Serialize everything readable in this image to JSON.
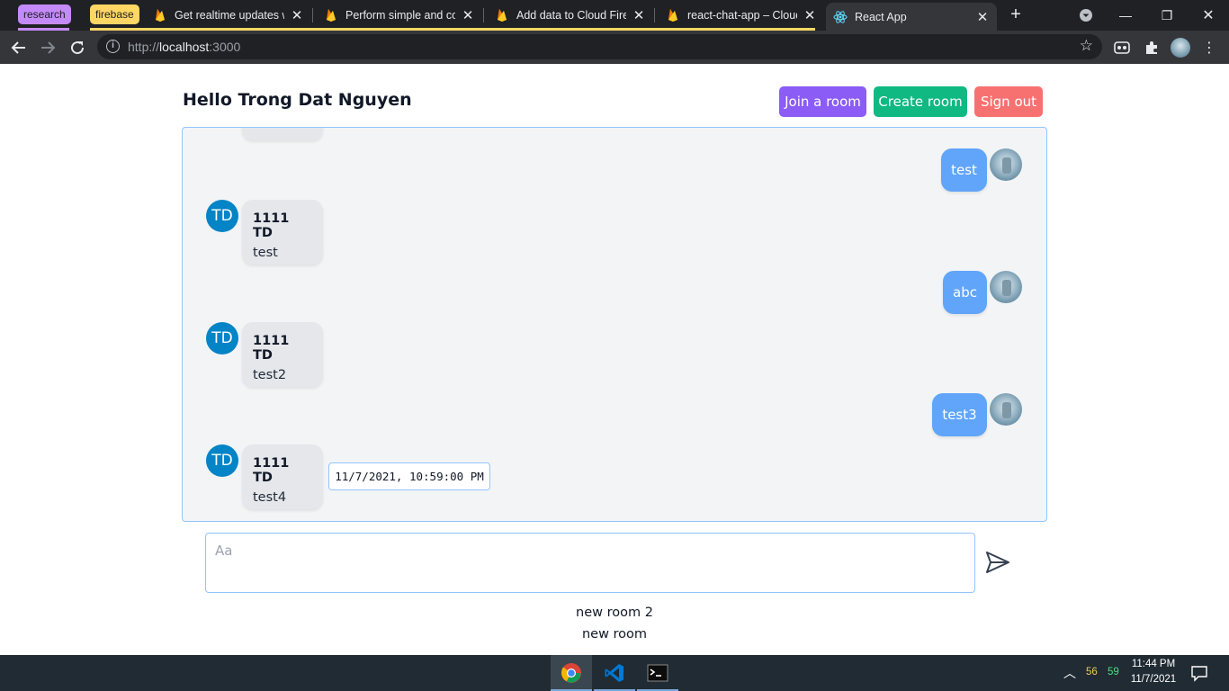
{
  "browser": {
    "tab_groups": [
      {
        "label": "research",
        "color": "#c58af9"
      },
      {
        "label": "firebase",
        "color": "#fdd663"
      }
    ],
    "tabs": [
      {
        "title": "Get realtime updates wi",
        "icon": "firebase-icon"
      },
      {
        "title": "Perform simple and com",
        "icon": "firebase-icon"
      },
      {
        "title": "Add data to Cloud Fires",
        "icon": "firebase-icon"
      },
      {
        "title": "react-chat-app – Cloud",
        "icon": "firebase-icon"
      },
      {
        "title": "React App",
        "icon": "react-icon",
        "active": true
      }
    ],
    "url_host": "localhost",
    "url_prefix": "http://",
    "url_suffix": ":3000"
  },
  "header": {
    "greeting": "Hello Trong Dat Nguyen",
    "join_label": "Join a room",
    "create_label": "Create room",
    "signout_label": "Sign out"
  },
  "chat": {
    "messages": [
      {
        "direction": "out",
        "text": "test"
      },
      {
        "direction": "in",
        "avatar": "TD",
        "sender": "1111 TD",
        "text": "test"
      },
      {
        "direction": "out",
        "text": "abc"
      },
      {
        "direction": "in",
        "avatar": "TD",
        "sender": "1111 TD",
        "text": "test2"
      },
      {
        "direction": "out",
        "text": "test3"
      },
      {
        "direction": "in",
        "avatar": "TD",
        "sender": "1111 TD",
        "text": "test4"
      }
    ],
    "timestamp_tooltip": "11/7/2021, 10:59:00 PM"
  },
  "composer": {
    "placeholder": "Aa",
    "value": ""
  },
  "rooms": [
    "new room 2",
    "new room"
  ],
  "taskbar": {
    "apps": [
      "chrome-icon",
      "vscode-icon",
      "terminal-icon"
    ],
    "tray_num_1": "56",
    "tray_num_2": "59",
    "time": "11:44 PM",
    "date": "11/7/2021"
  }
}
